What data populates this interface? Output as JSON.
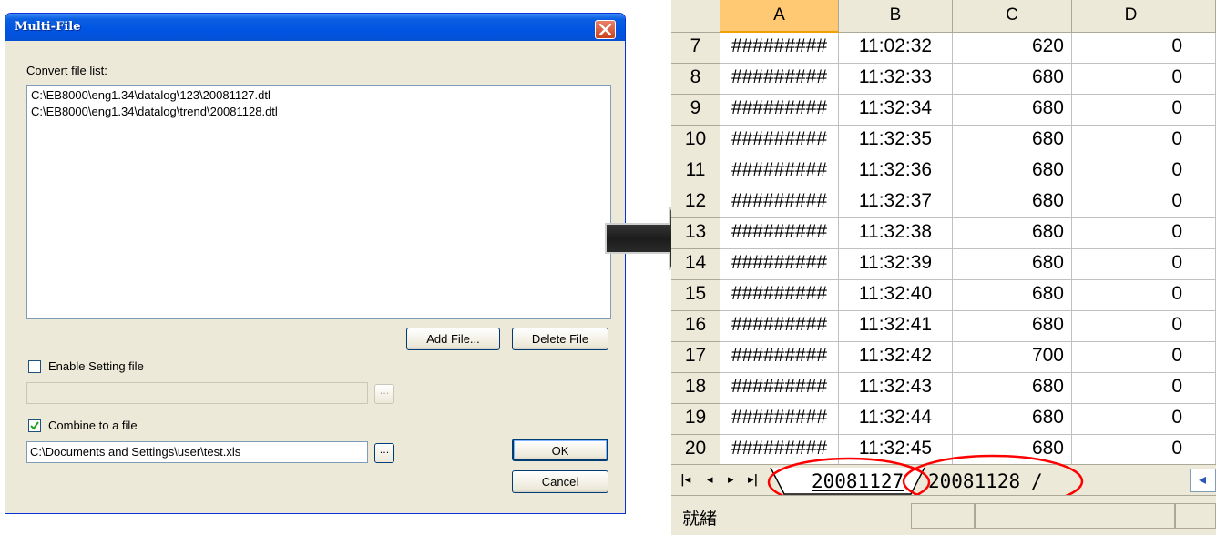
{
  "dialog": {
    "title": "Multi-File",
    "list_label": "Convert file list:",
    "files": [
      "C:\\EB8000\\eng1.34\\datalog\\123\\20081127.dtl",
      "C:\\EB8000\\eng1.34\\datalog\\trend\\20081128.dtl"
    ],
    "add_file_label": "Add File...",
    "delete_file_label": "Delete File",
    "enable_setting_label": "Enable Setting file",
    "enable_setting_checked": false,
    "setting_file_value": "",
    "combine_label": "Combine to a file",
    "combine_checked": true,
    "combine_file_value": "C:\\Documents and Settings\\user\\test.xls",
    "browse_label": "...",
    "ok_label": "OK",
    "cancel_label": "Cancel"
  },
  "sheet": {
    "columns": [
      "A",
      "B",
      "C",
      "D"
    ],
    "selected_column": "A",
    "rows": [
      {
        "num": "7",
        "a": "#########",
        "b": "11:02:32",
        "c": "620",
        "d": "0"
      },
      {
        "num": "8",
        "a": "#########",
        "b": "11:32:33",
        "c": "680",
        "d": "0"
      },
      {
        "num": "9",
        "a": "#########",
        "b": "11:32:34",
        "c": "680",
        "d": "0"
      },
      {
        "num": "10",
        "a": "#########",
        "b": "11:32:35",
        "c": "680",
        "d": "0"
      },
      {
        "num": "11",
        "a": "#########",
        "b": "11:32:36",
        "c": "680",
        "d": "0"
      },
      {
        "num": "12",
        "a": "#########",
        "b": "11:32:37",
        "c": "680",
        "d": "0"
      },
      {
        "num": "13",
        "a": "#########",
        "b": "11:32:38",
        "c": "680",
        "d": "0"
      },
      {
        "num": "14",
        "a": "#########",
        "b": "11:32:39",
        "c": "680",
        "d": "0"
      },
      {
        "num": "15",
        "a": "#########",
        "b": "11:32:40",
        "c": "680",
        "d": "0"
      },
      {
        "num": "16",
        "a": "#########",
        "b": "11:32:41",
        "c": "680",
        "d": "0"
      },
      {
        "num": "17",
        "a": "#########",
        "b": "11:32:42",
        "c": "700",
        "d": "0"
      },
      {
        "num": "18",
        "a": "#########",
        "b": "11:32:43",
        "c": "680",
        "d": "0"
      },
      {
        "num": "19",
        "a": "#########",
        "b": "11:32:44",
        "c": "680",
        "d": "0"
      },
      {
        "num": "20",
        "a": "#########",
        "b": "11:32:45",
        "c": "680",
        "d": "0"
      }
    ],
    "tabs": [
      "20081127",
      "20081128"
    ],
    "active_tab": "20081127",
    "status": "就緒"
  },
  "colors": {
    "title_bar": "#0054e3",
    "dialog_bg": "#ece9d8",
    "highlight_circle": "#ff0000",
    "arrow": "#333333"
  }
}
